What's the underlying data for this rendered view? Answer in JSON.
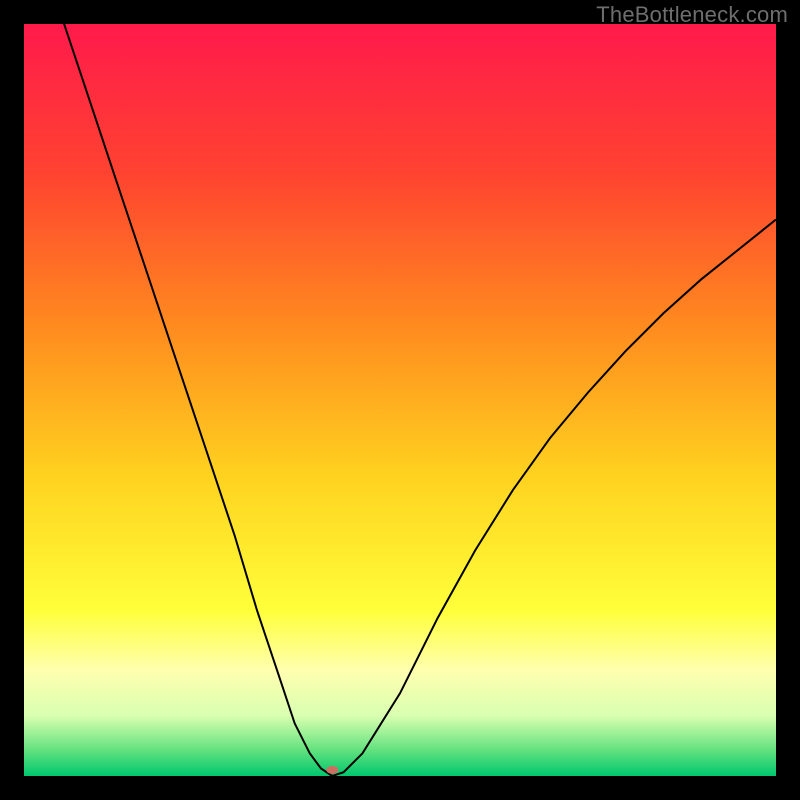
{
  "watermark": "TheBottleneck.com",
  "chart_data": {
    "type": "line",
    "title": "",
    "xlabel": "",
    "ylabel": "",
    "xlim": [
      0,
      100
    ],
    "ylim": [
      0,
      100
    ],
    "background_gradient": {
      "stops": [
        {
          "offset": 0.0,
          "color": "#ff1a4b"
        },
        {
          "offset": 0.2,
          "color": "#ff4330"
        },
        {
          "offset": 0.4,
          "color": "#ff8a1f"
        },
        {
          "offset": 0.6,
          "color": "#ffd21f"
        },
        {
          "offset": 0.78,
          "color": "#ffff3a"
        },
        {
          "offset": 0.86,
          "color": "#ffffb0"
        },
        {
          "offset": 0.92,
          "color": "#d9ffb0"
        },
        {
          "offset": 0.965,
          "color": "#64e27f"
        },
        {
          "offset": 1.0,
          "color": "#00c86e"
        }
      ]
    },
    "series": [
      {
        "name": "bottleneck-curve",
        "color": "#000000",
        "width": 2,
        "x": [
          0,
          4,
          8,
          12,
          16,
          20,
          24,
          28,
          31,
          34,
          36,
          38,
          39.5,
          41,
          42.5,
          45,
          50,
          55,
          60,
          65,
          70,
          75,
          80,
          85,
          90,
          95,
          100
        ],
        "values": [
          116,
          104,
          92,
          80,
          68,
          56,
          44,
          32,
          22,
          13,
          7,
          3,
          1,
          0,
          0.5,
          3,
          11,
          21,
          30,
          38,
          45,
          51,
          56.5,
          61.5,
          66,
          70,
          74
        ]
      }
    ],
    "marker": {
      "name": "optimum-point",
      "x": 41,
      "y": 0.8,
      "rx": 6,
      "ry": 4,
      "color": "#cc6f62"
    }
  }
}
